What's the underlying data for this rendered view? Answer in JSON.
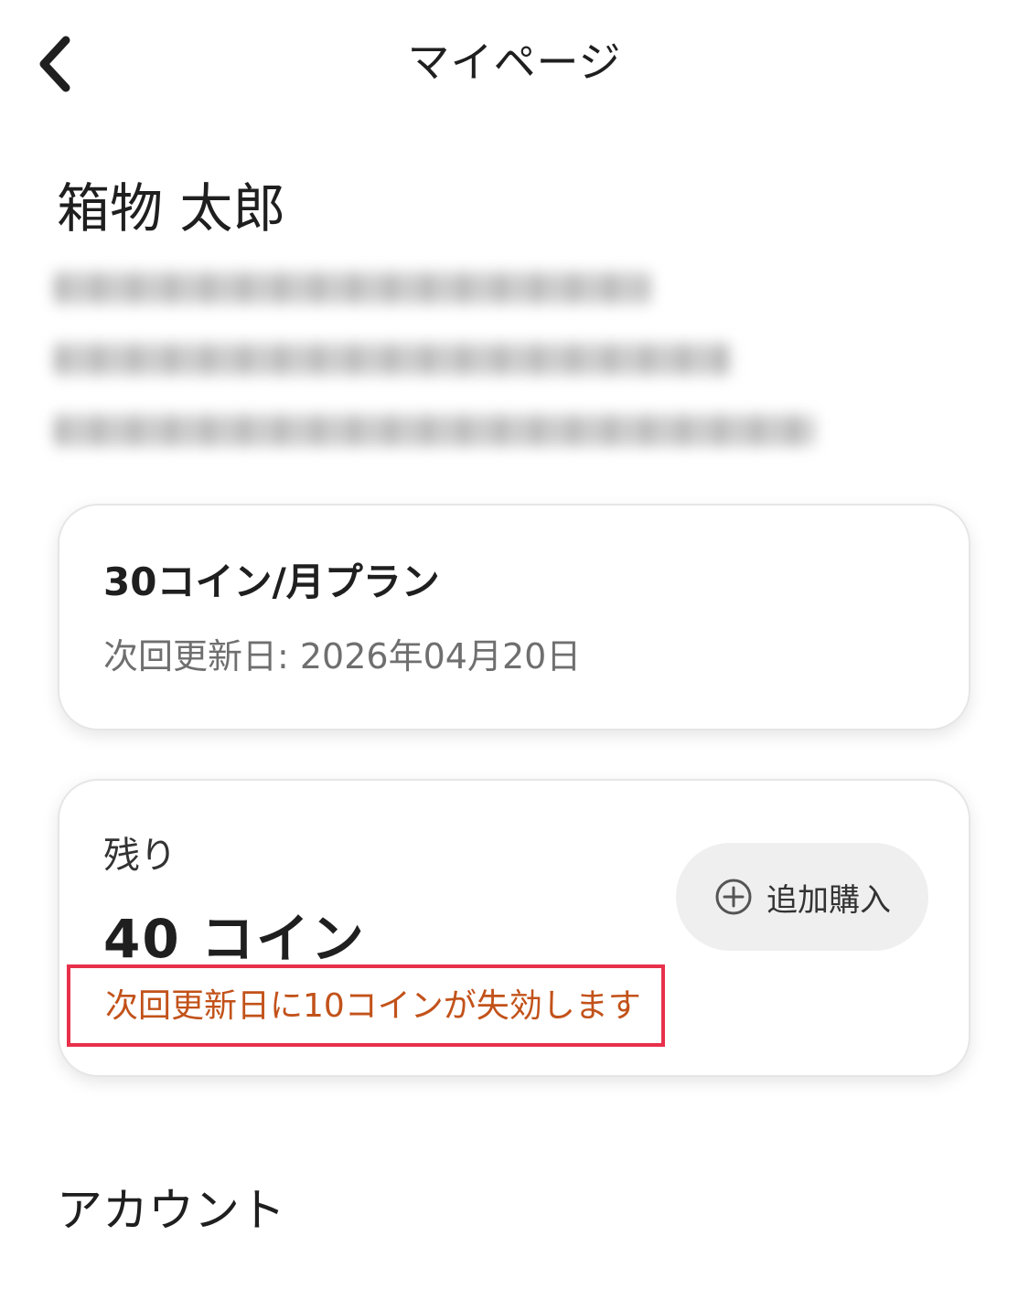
{
  "header": {
    "title": "マイページ",
    "back_icon": "chevron-left-icon"
  },
  "profile": {
    "name": "箱物 太郎",
    "redacted_lines": 3
  },
  "plan_card": {
    "plan_name": "30コイン/月プラン",
    "renewal_text": "次回更新日: 2026年04月20日"
  },
  "coin_card": {
    "remaining_label": "残り",
    "coin_amount": "40 コイン",
    "buy_button_label": "追加購入",
    "buy_button_icon": "plus-circle-icon",
    "expire_note": "次回更新日に10コインが失効します"
  },
  "colors": {
    "highlight_border": "#e8304a",
    "warning_text": "#c2521a",
    "button_bg": "#efefef"
  },
  "sections": {
    "account_title": "アカウント"
  }
}
